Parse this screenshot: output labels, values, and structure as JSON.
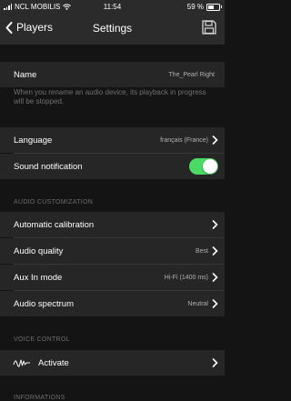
{
  "status": {
    "carrier": "NCL MOBILIS",
    "time": "11:54",
    "battery": "59 %",
    "battery_level": 0.59
  },
  "nav": {
    "back_label": "Players",
    "title": "Settings"
  },
  "name_row": {
    "label": "Name",
    "value": "The_Pearl Right"
  },
  "rename_note": "When you rename an audio device, its playback in progress will be stopped.",
  "language_row": {
    "label": "Language",
    "value": "français (France)"
  },
  "sound_row": {
    "label": "Sound notification",
    "enabled": true
  },
  "audio_section": {
    "header": "AUDIO CUSTOMIZATION",
    "items": [
      {
        "label": "Automatic calibration",
        "value": ""
      },
      {
        "label": "Audio quality",
        "value": "Best"
      },
      {
        "label": "Aux In mode",
        "value": "Hi-Fi (1400 ms)"
      },
      {
        "label": "Audio spectrum",
        "value": "Neutral"
      }
    ]
  },
  "voice_section": {
    "header": "VOICE CONTROL",
    "activate_label": "Activate"
  },
  "info_section": {
    "header": "INFORMATIONS"
  },
  "colors": {
    "toggle_on": "#4cd964",
    "row_bg": "#262626",
    "page_bg": "#141414",
    "bar_bg": "#2b2b2b"
  }
}
